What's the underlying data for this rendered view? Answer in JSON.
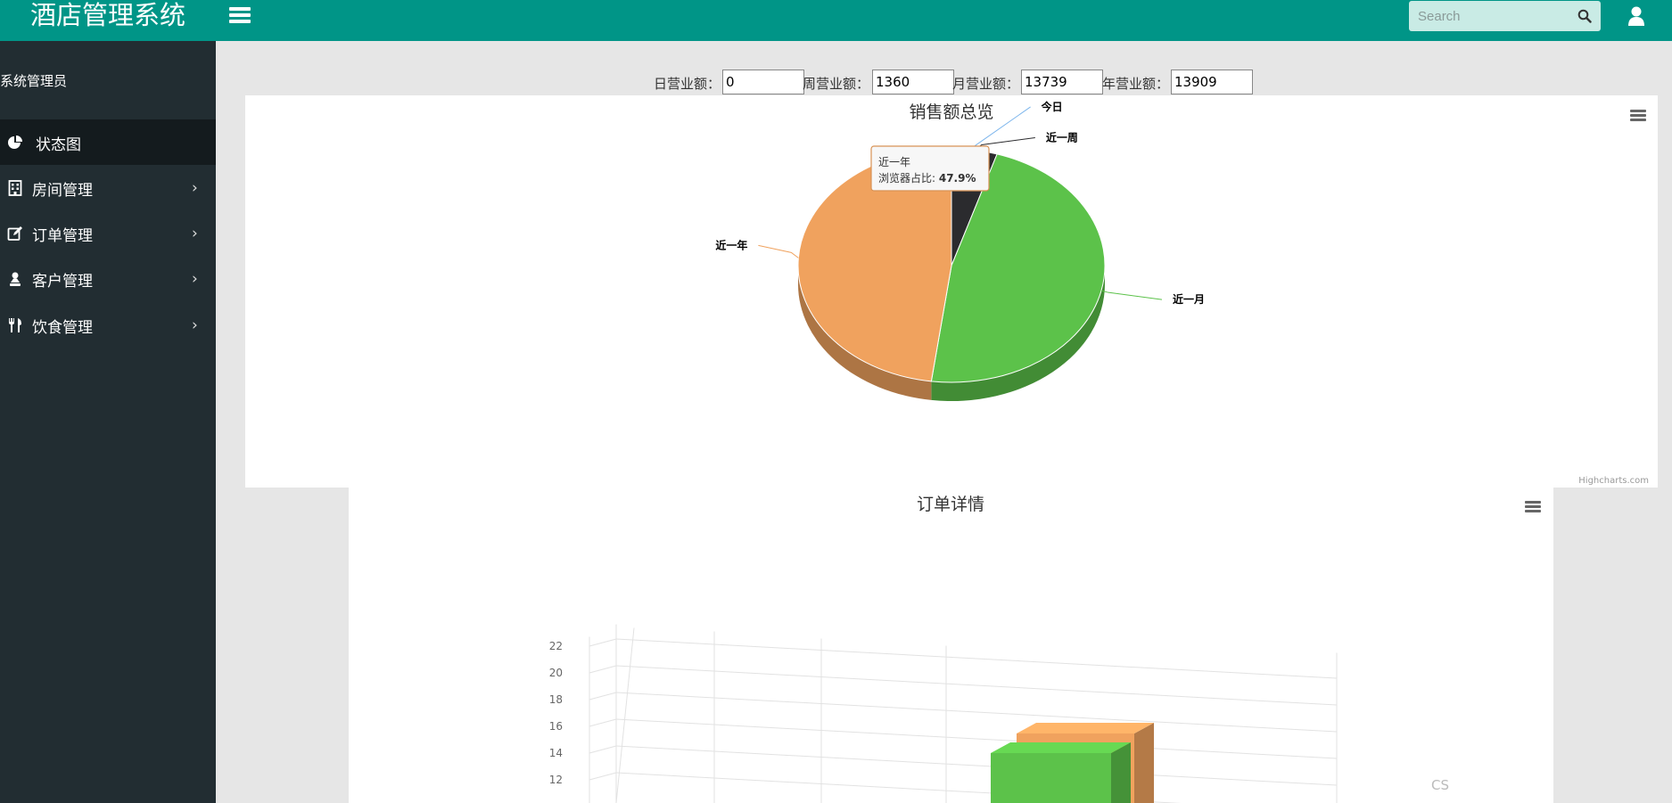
{
  "app": {
    "title": "酒店管理系统"
  },
  "header": {
    "search_placeholder": "Search",
    "icons": [
      "menu-icon",
      "search-icon",
      "user-icon"
    ]
  },
  "sidebar": {
    "user": "系统管理员",
    "items": [
      {
        "label": "状态图",
        "icon": "pie-chart-icon",
        "active": true
      },
      {
        "label": "房间管理",
        "icon": "building-icon"
      },
      {
        "label": "订单管理",
        "icon": "edit-icon"
      },
      {
        "label": "客户管理",
        "icon": "user-icon"
      },
      {
        "label": "饮食管理",
        "icon": "cutlery-icon"
      }
    ]
  },
  "kpis": [
    {
      "label": "日营业额：",
      "value": "0"
    },
    {
      "label": "周营业额：",
      "value": "1360"
    },
    {
      "label": "月营业额：",
      "value": "13739"
    },
    {
      "label": "年营业额：",
      "value": "13909"
    }
  ],
  "credit": "Highcharts.com",
  "watermark": "CS",
  "chart_data": [
    {
      "type": "pie",
      "title": "销售额总览",
      "slices": [
        {
          "name": "今日",
          "value": 0,
          "color": "#7cb5ec"
        },
        {
          "name": "近一周",
          "value": 4.8,
          "color": "#2b2b2e"
        },
        {
          "name": "近一月",
          "value": 47.3,
          "color": "#5cc24a"
        },
        {
          "name": "近一年",
          "value": 47.9,
          "color": "#f0a25e"
        }
      ],
      "tooltip": {
        "name": "近一年",
        "label": "浏览器占比",
        "value": "47.9%"
      }
    },
    {
      "type": "bar",
      "title": "订单详情",
      "y_ticks": [
        12,
        14,
        16,
        18,
        20,
        22
      ],
      "ylim": [
        10,
        22
      ],
      "series": [
        {
          "values": [
            16
          ],
          "color": "#f0a25e"
        },
        {
          "values": [
            14
          ],
          "color": "#5cc24a"
        }
      ]
    }
  ]
}
